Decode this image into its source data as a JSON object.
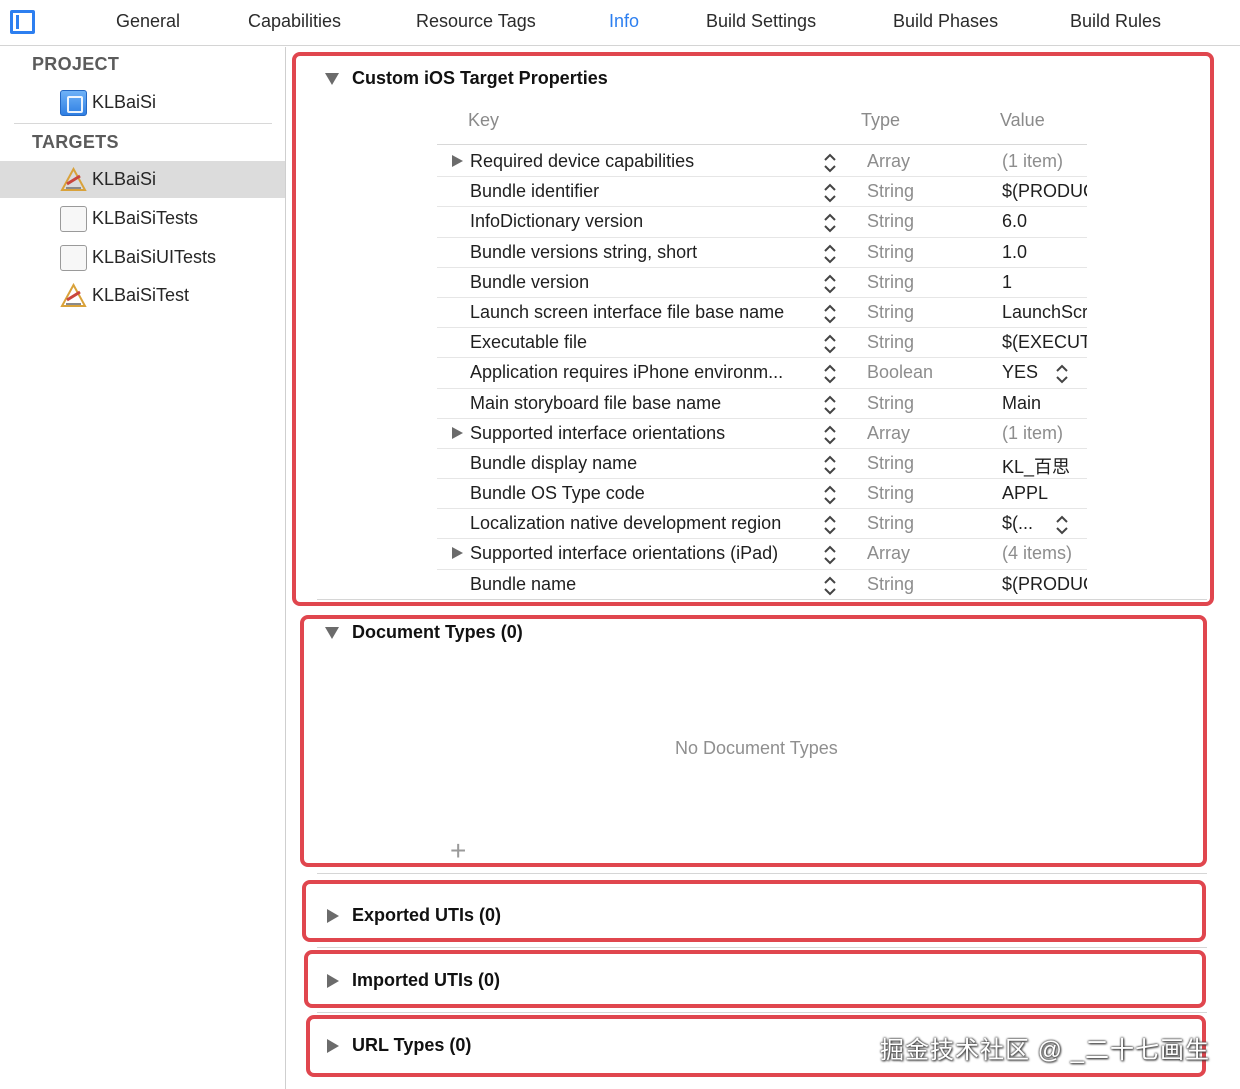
{
  "tabs": [
    {
      "label": "General"
    },
    {
      "label": "Capabilities"
    },
    {
      "label": "Resource Tags"
    },
    {
      "label": "Info",
      "active": true
    },
    {
      "label": "Build Settings"
    },
    {
      "label": "Build Phases"
    },
    {
      "label": "Build Rules"
    }
  ],
  "sidebar": {
    "project_header": "PROJECT",
    "project_item": "KLBaiSi",
    "targets_header": "TARGETS",
    "targets": [
      {
        "label": "KLBaiSi",
        "icon": "app-target-icon",
        "selected": true
      },
      {
        "label": "KLBaiSiTests",
        "icon": "test-bundle-icon"
      },
      {
        "label": "KLBaiSiUITests",
        "icon": "test-bundle-icon"
      },
      {
        "label": "KLBaiSiTest",
        "icon": "app-target-icon"
      }
    ]
  },
  "custom_props": {
    "title": "Custom iOS Target Properties",
    "columns": {
      "key": "Key",
      "type": "Type",
      "value": "Value"
    },
    "rows": [
      {
        "key": "Required device capabilities",
        "type": "Array",
        "value": "(1 item)",
        "expandable": true
      },
      {
        "key": "Bundle identifier",
        "type": "String",
        "value": "$(PRODUCT_BUNDLE_IDENTIFIER)"
      },
      {
        "key": "InfoDictionary version",
        "type": "String",
        "value": "6.0"
      },
      {
        "key": "Bundle versions string, short",
        "type": "String",
        "value": "1.0"
      },
      {
        "key": "Bundle version",
        "type": "String",
        "value": "1"
      },
      {
        "key": "Launch screen interface file base name",
        "type": "String",
        "value": "LaunchScreen"
      },
      {
        "key": "Executable file",
        "type": "String",
        "value": "$(EXECUTABLE_NAME)"
      },
      {
        "key": "Application requires iPhone environm...",
        "type": "Boolean",
        "value": "YES",
        "value_stepper": true
      },
      {
        "key": "Main storyboard file base name",
        "type": "String",
        "value": "Main"
      },
      {
        "key": "Supported interface orientations",
        "type": "Array",
        "value": "(1 item)",
        "expandable": true
      },
      {
        "key": "Bundle display name",
        "type": "String",
        "value": "KL_百思"
      },
      {
        "key": "Bundle OS Type code",
        "type": "String",
        "value": "APPL"
      },
      {
        "key": "Localization native development region",
        "type": "String",
        "value": "$(...",
        "value_stepper": true
      },
      {
        "key": "Supported interface orientations (iPad)",
        "type": "Array",
        "value": "(4 items)",
        "expandable": true
      },
      {
        "key": "Bundle name",
        "type": "String",
        "value": "$(PRODUCT_NAME)"
      }
    ]
  },
  "document_types": {
    "title": "Document Types (0)",
    "empty_text": "No Document Types",
    "add_label": "+"
  },
  "exported_utis": {
    "title": "Exported UTIs (0)"
  },
  "imported_utis": {
    "title": "Imported UTIs (0)"
  },
  "url_types": {
    "title": "URL Types (0)"
  },
  "watermark": "掘金技术社区 @ _二十七画生",
  "colors": {
    "accent": "#2d7ff0",
    "highlight_box": "#e0464e",
    "selected_row": "#dcdcdc"
  }
}
